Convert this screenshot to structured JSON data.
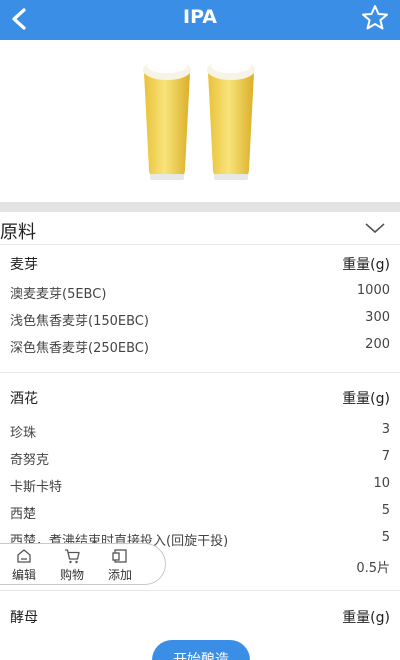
{
  "header": {
    "title": "IPA"
  },
  "section": {
    "label": "原料"
  },
  "malt": {
    "title": "麦芽",
    "unit": "重量(g)",
    "items": [
      {
        "name": "澳麦麦芽(5EBC)",
        "value": "1000"
      },
      {
        "name": "浅色焦香麦芽(150EBC)",
        "value": "300"
      },
      {
        "name": "深色焦香麦芽(250EBC)",
        "value": "200"
      }
    ]
  },
  "hops": {
    "title": "酒花",
    "unit": "重量(g)",
    "items": [
      {
        "name": "珍珠",
        "value": "3"
      },
      {
        "name": "奇努克",
        "value": "7"
      },
      {
        "name": "卡斯卡特",
        "value": "10"
      },
      {
        "name": "西楚",
        "value": "5"
      },
      {
        "name": "西楚，煮沸结束时直接投入(回旋干投)",
        "value": "5"
      },
      {
        "name": "",
        "value": "0.5片"
      }
    ]
  },
  "yeast": {
    "title": "酵母",
    "unit": "重量(g)"
  },
  "toolbar": {
    "edit": "编辑",
    "shop": "购物",
    "add": "添加"
  },
  "footer": {
    "start_button": "开始酿造"
  },
  "colors": {
    "primary": "#3a8ee6"
  }
}
